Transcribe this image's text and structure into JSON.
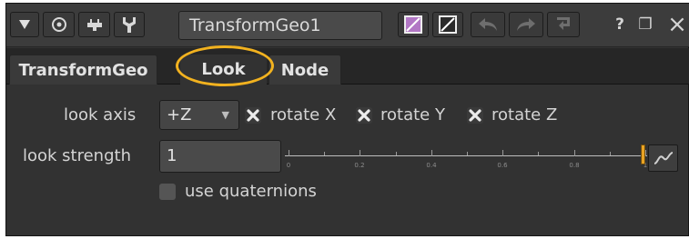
{
  "toolbar": {
    "node_name": "TransformGeo1",
    "icons": [
      "collapse-triangle-icon",
      "viewer-target-icon",
      "plug-icon",
      "wrench-icon",
      "node-color-icon",
      "node-color-reset-icon",
      "undo-icon",
      "redo-icon",
      "revert-icon",
      "help-icon",
      "float-panel-icon",
      "close-icon"
    ],
    "help_glyph": "?",
    "float_glyph": "❐",
    "close_glyph": "×"
  },
  "tabs": [
    {
      "label": "TransformGeo",
      "active": false
    },
    {
      "label": "Look",
      "active": true
    },
    {
      "label": "Node",
      "active": false
    }
  ],
  "look": {
    "axis_label": "look axis",
    "axis_value": "+Z",
    "rotate_x_label": "rotate X",
    "rotate_x_checked": true,
    "rotate_y_label": "rotate Y",
    "rotate_y_checked": true,
    "rotate_z_label": "rotate Z",
    "rotate_z_checked": true,
    "strength_label": "look strength",
    "strength_value": "1",
    "slider_ticks": [
      "0",
      "0.2",
      "0.4",
      "0.6",
      "0.8",
      "1"
    ],
    "use_quaternions_label": "use quaternions",
    "use_quaternions_checked": false
  },
  "colors": {
    "panel_bg": "#323232",
    "highlight_ring": "#f2b21f",
    "slider_handle": "#e9a324",
    "node_color_purple": "#b277c5"
  }
}
